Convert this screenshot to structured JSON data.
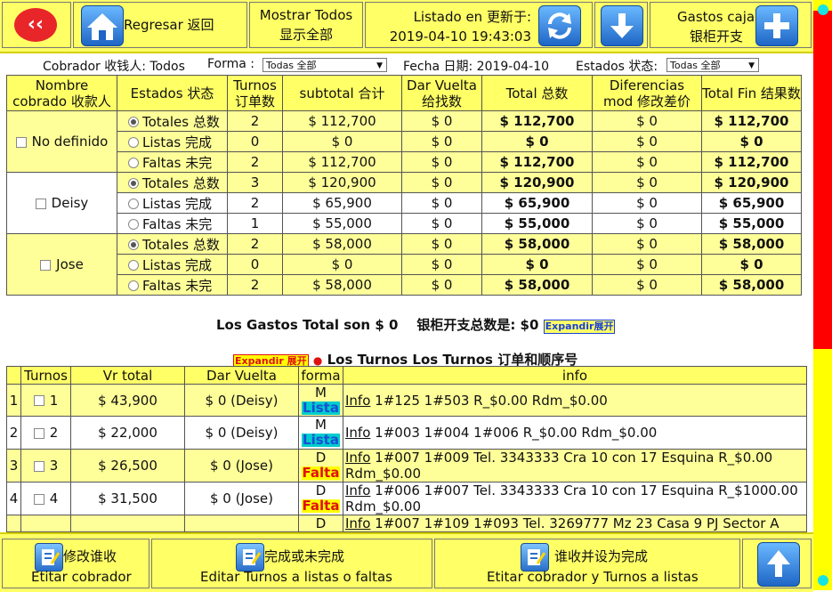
{
  "toolbar": {
    "back_glyph": "‹‹",
    "home_label": "Regresar 返回",
    "show_all_line1": "Mostrar Todos",
    "show_all_line2": "显示全部",
    "updated_line1": "Listado en 更新于:",
    "updated_line2": "2019-04-10 19:43:03",
    "gastos_line1": "Gastos caja",
    "gastos_line2": "银柜开支",
    "icons": [
      "back-icon",
      "home-icon",
      "refresh-icon",
      "download-icon",
      "add-icon"
    ]
  },
  "filters": {
    "cobrador_label": "Cobrador 收钱人: Todos",
    "forma_label": "Forma :",
    "forma_value": "Todas 全部",
    "fecha_label": "Fecha 日期: 2019-04-10",
    "estados_label": "Estados 状态:",
    "estados_value": "Todas 全部"
  },
  "summary": {
    "headers": {
      "col_name": "Nombre cobrado 收款人",
      "col_state": "Estados 状态",
      "col_turns": "Turnos 订单数",
      "col_subtotal": "subtotal 合计",
      "col_vuelta": "Dar Vuelta 给找数",
      "col_total": "Total 总数",
      "col_diff": "Diferencias mod 修改差价",
      "col_fin": "Total Fin 结果数"
    },
    "groups": [
      {
        "name": "No definido",
        "rows": [
          {
            "state": "Totales 总数",
            "turns": "2",
            "subtotal": "$ 112,700",
            "vuelta": "$ 0",
            "total": "$ 112,700",
            "diff": "$ 0",
            "fin": "$ 112,700"
          },
          {
            "state": "Listas 完成",
            "turns": "0",
            "subtotal": "$ 0",
            "vuelta": "$ 0",
            "total": "$ 0",
            "diff": "$ 0",
            "fin": "$ 0"
          },
          {
            "state": "Faltas 未完",
            "turns": "2",
            "subtotal": "$ 112,700",
            "vuelta": "$ 0",
            "total": "$ 112,700",
            "diff": "$ 0",
            "fin": "$ 112,700"
          }
        ]
      },
      {
        "name": "Deisy",
        "rows": [
          {
            "state": "Totales 总数",
            "turns": "3",
            "subtotal": "$ 120,900",
            "vuelta": "$ 0",
            "total": "$ 120,900",
            "diff": "$ 0",
            "fin": "$ 120,900"
          },
          {
            "state": "Listas 完成",
            "turns": "2",
            "subtotal": "$ 65,900",
            "vuelta": "$ 0",
            "total": "$ 65,900",
            "diff": "$ 0",
            "fin": "$ 65,900"
          },
          {
            "state": "Faltas 未完",
            "turns": "1",
            "subtotal": "$ 55,000",
            "vuelta": "$ 0",
            "total": "$ 55,000",
            "diff": "$ 0",
            "fin": "$ 55,000"
          }
        ]
      },
      {
        "name": "Jose",
        "rows": [
          {
            "state": "Totales 总数",
            "turns": "2",
            "subtotal": "$ 58,000",
            "vuelta": "$ 0",
            "total": "$ 58,000",
            "diff": "$ 0",
            "fin": "$ 58,000"
          },
          {
            "state": "Listas 完成",
            "turns": "0",
            "subtotal": "$ 0",
            "vuelta": "$ 0",
            "total": "$ 0",
            "diff": "$ 0",
            "fin": "$ 0"
          },
          {
            "state": "Faltas 未完",
            "turns": "2",
            "subtotal": "$ 58,000",
            "vuelta": "$ 0",
            "total": "$ 58,000",
            "diff": "$ 0",
            "fin": "$ 58,000"
          }
        ]
      }
    ]
  },
  "gastos_line": {
    "text": "Los Gastos Total son $ 0    银柜开支总数是: $0",
    "expand": "Expandir展开"
  },
  "turns_title": {
    "expand": "Expandir 展开",
    "bullet": "●",
    "text": "Los Turnos Los Turnos 订单和顺序号"
  },
  "turns": {
    "headers": {
      "turnos": "Turnos",
      "vr_total": "Vr total",
      "vuelta": "Dar Vuelta",
      "forma": "forma",
      "info": "info"
    },
    "rows": [
      {
        "idx": "1",
        "num": "1",
        "vr": "$ 43,900",
        "vuelta": "$ 0 (Deisy)",
        "forma": "M",
        "tag": "Lista",
        "info_link": "Info",
        "info": " 1#125 1#503 R_$0.00 Rdm_$0.00"
      },
      {
        "idx": "2",
        "num": "2",
        "vr": "$ 22,000",
        "vuelta": "$ 0 (Deisy)",
        "forma": "M",
        "tag": "Lista",
        "info_link": "Info",
        "info": " 1#003 1#004 1#006 R_$0.00 Rdm_$0.00"
      },
      {
        "idx": "3",
        "num": "3",
        "vr": "$ 26,500",
        "vuelta": "$ 0 (Jose)",
        "forma": "D",
        "tag": "Falta",
        "info_link": "Info",
        "info": " 1#007 1#009 Tel. 3343333 Cra 10 con 17 Esquina R_$0.00 Rdm_$0.00"
      },
      {
        "idx": "4",
        "num": "4",
        "vr": "$ 31,500",
        "vuelta": "$ 0 (Jose)",
        "forma": "D",
        "tag": "Falta",
        "info_link": "Info",
        "info": " 1#006 1#007 Tel. 3343333 Cra 10 con 17 Esquina R_$1000.00 Rdm_$0.00"
      },
      {
        "idx": "",
        "num": "",
        "vr": "",
        "vuelta": "",
        "forma": "D",
        "tag": "",
        "info_link": "Info",
        "info": " 1#007 1#109 1#093 Tel. 3269777 Mz 23 Casa 9 PJ Sector A"
      }
    ]
  },
  "bottom": {
    "btn1_line1": "修改谁收",
    "btn1_line2": "Etitar cobrador",
    "btn2_line1": "完成或未完成",
    "btn2_line2": "Editar Turnos a listas o faltas",
    "btn3_line1": "谁收并设为完成",
    "btn3_line2": "Etitar cobrador y Turnos a listas"
  },
  "colors": {
    "toolbar": "#ffff66",
    "row_yellow": "#ffff99",
    "lista_bg": "#00cccc",
    "lista_fg": "#1a4fd6",
    "falta_bg": "#ffff00",
    "falta_fg": "#e01010",
    "scroll_thumb": "#ff0000"
  }
}
